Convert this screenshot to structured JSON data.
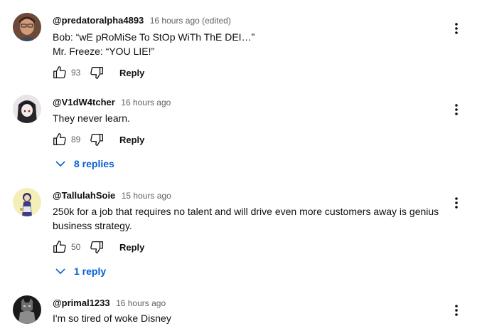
{
  "comments": [
    {
      "author": "@predatoralpha4893",
      "time": "16 hours ago (edited)",
      "text_lines": [
        "Bob: “wE pRoMiSe To StOp WiTh ThE DEI…”",
        "Mr. Freeze: “YOU LIE!”"
      ],
      "likes": "93",
      "reply_label": "Reply",
      "avatar_icon": "avatar-man-portrait",
      "avatar_colors": [
        "#5b3a2c",
        "#c98b6a"
      ]
    },
    {
      "author": "@V1dW4tcher",
      "time": "16 hours ago",
      "text_lines": [
        "They never learn."
      ],
      "likes": "89",
      "reply_label": "Reply",
      "replies_label": "8 replies",
      "avatar_icon": "avatar-dark-anime",
      "avatar_colors": [
        "#2a2a2e",
        "#e8e0dc"
      ]
    },
    {
      "author": "@TallulahSoie",
      "time": "15 hours ago",
      "text_lines": [
        "250k for a job that requires no talent and will drive even more customers away is genius",
        "business strategy."
      ],
      "likes": "50",
      "reply_label": "Reply",
      "replies_label": "1 reply",
      "avatar_icon": "avatar-yellow-illustration",
      "avatar_colors": [
        "#f3e8a8",
        "#2b2f6b"
      ]
    },
    {
      "author": "@primal1233",
      "time": "16 hours ago",
      "text_lines": [
        "I'm so tired of woke Disney"
      ],
      "likes": "",
      "reply_label": "",
      "avatar_icon": "avatar-dark-armor",
      "avatar_colors": [
        "#1c1c1c",
        "#8a8a8a"
      ]
    }
  ],
  "icons": {
    "like": "thumbs-up-icon",
    "dislike": "thumbs-down-icon",
    "more": "more-vertical-icon",
    "expand": "chevron-down-icon"
  },
  "colors": {
    "text": "#0f0f0f",
    "secondary": "#606060",
    "link": "#065fd4"
  }
}
